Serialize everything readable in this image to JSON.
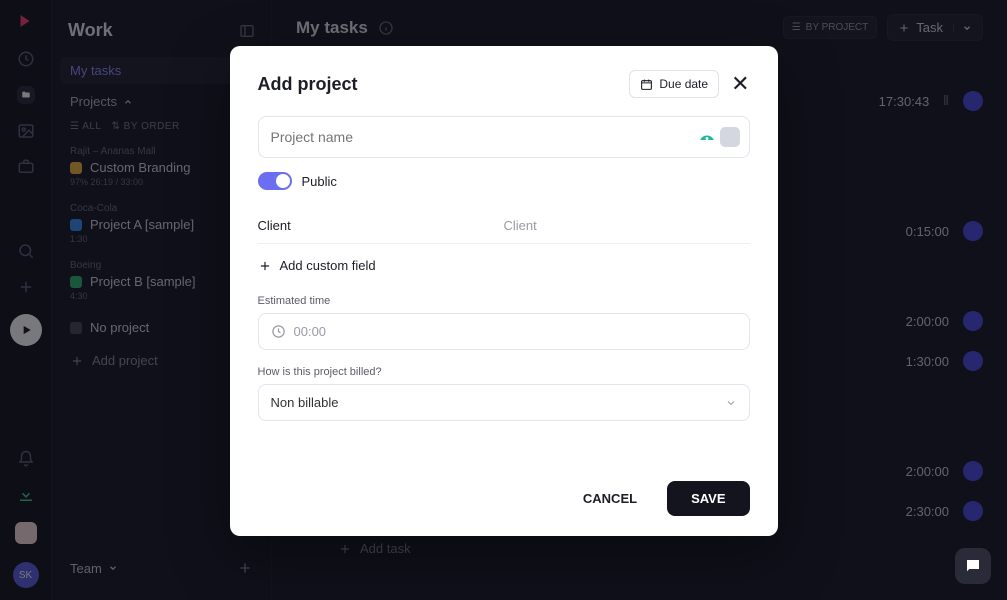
{
  "rail": {
    "avatar": "SK"
  },
  "sidebar": {
    "title": "Work",
    "tab_mytasks": "My tasks",
    "projects_label": "Projects",
    "filter_all": "ALL",
    "filter_order": "BY ORDER",
    "projects": [
      {
        "client": "Rajit – Ananas Mall",
        "name": "Custom Branding",
        "meta": "97%   26:19 / 33:00",
        "color": "#f0b63a"
      },
      {
        "client": "Coca-Cola",
        "name": "Project A [sample]",
        "meta": "1:30",
        "color": "#3a8df0"
      },
      {
        "client": "Boeing",
        "name": "Project B [sample]",
        "meta": "4:30",
        "color": "#2fb36a"
      },
      {
        "client": "",
        "name": "No project",
        "meta": "",
        "color": "#4a4b5b"
      }
    ],
    "add_project": "Add project",
    "team_label": "Team"
  },
  "main": {
    "title": "My tasks",
    "by_project": "BY PROJECT",
    "task_btn": "Task",
    "tasks": [
      {
        "dur": "17:30:43"
      },
      {
        "dur": "0:15:00"
      },
      {
        "dur": "2:00:00"
      },
      {
        "dur": "1:30:00"
      },
      {
        "dur": "2:00:00"
      },
      {
        "dur": "2:30:00"
      }
    ],
    "add_task": "Add task"
  },
  "modal": {
    "title": "Add project",
    "due_date": "Due date",
    "name_placeholder": "Project name",
    "public_label": "Public",
    "client_key": "Client",
    "client_value": "Client",
    "add_field": "Add custom field",
    "est_label": "Estimated time",
    "est_value": "00:00",
    "billed_label": "How is this project billed?",
    "billed_value": "Non billable",
    "cancel": "CANCEL",
    "save": "SAVE"
  }
}
